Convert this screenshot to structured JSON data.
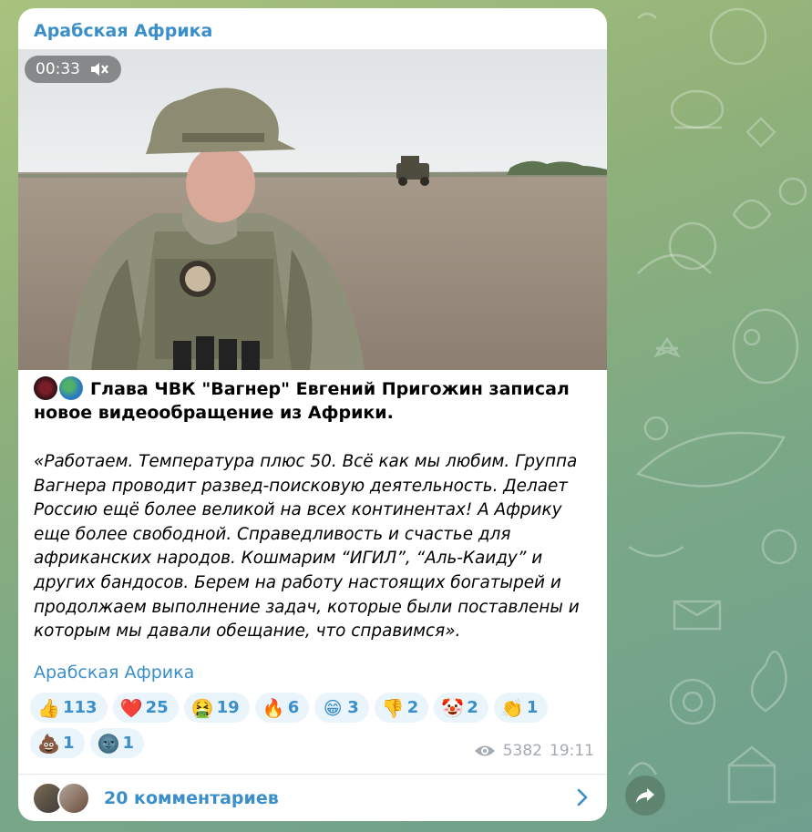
{
  "channel": {
    "title": "Арабская Африка",
    "signature": "Арабская Африка"
  },
  "video": {
    "duration": "00:33",
    "muted": true
  },
  "post": {
    "headline": "Глава ЧВК \"Вагнер\" Евгений Пригожин записал новое видеообращение из Африки.",
    "quote": "«Работаем. Температура плюс 50. Всё как мы любим. Группа Вагнера проводит развед-поисковую деятельность. Делает Россию ещё более великой на всех континентах! А Африку еще более свободной. Справедливость и счастье для африканских народов. Кошмарим “ИГИЛ”, “Аль-Каиду” и других бандосов. Берем на работу настоящих богатырей и продолжаем выполнение задач, которые были поставлены и которым мы давали обещание, что справимся»."
  },
  "reactions": [
    {
      "icon": "👍",
      "name": "thumbs-up",
      "count": "113"
    },
    {
      "icon": "❤️",
      "name": "heart",
      "count": "25"
    },
    {
      "icon": "🤮",
      "name": "vomiting-face",
      "count": "19"
    },
    {
      "icon": "🔥",
      "name": "fire",
      "count": "6"
    },
    {
      "icon": "😁",
      "name": "grinning-face",
      "count": "3"
    },
    {
      "icon": "👎",
      "name": "thumbs-down",
      "count": "2"
    },
    {
      "icon": "🤡",
      "name": "clown-face",
      "count": "2"
    },
    {
      "icon": "👏",
      "name": "clapping-hands",
      "count": "1"
    },
    {
      "icon": "💩",
      "name": "pile-of-poo",
      "count": "1"
    },
    {
      "icon": "🌚",
      "name": "new-moon-face",
      "count": "1"
    }
  ],
  "meta": {
    "views": "5382",
    "time": "19:11"
  },
  "comments": {
    "label": "20 комментариев"
  },
  "colors": {
    "accent": "#3a8fcb",
    "reaction_bg": "#eaf4fb"
  }
}
